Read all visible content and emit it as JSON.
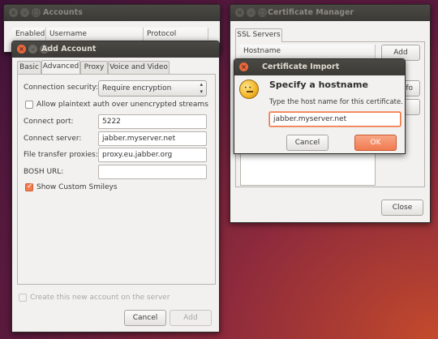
{
  "accounts": {
    "title": "Accounts",
    "columns": [
      "Enabled",
      "Username",
      "Protocol"
    ]
  },
  "cert_manager": {
    "title": "Certificate Manager",
    "tab": "SSL Servers",
    "column": "Hostname",
    "add_button": "Add",
    "info_button_partial": "fo",
    "close_button": "Close"
  },
  "add_account": {
    "title": "Add Account",
    "tabs": [
      "Basic",
      "Advanced",
      "Proxy",
      "Voice and Video"
    ],
    "active_tab": "Advanced",
    "security_label": "Connection security:",
    "security_value": "Require encryption",
    "plaintext_label": "Allow plaintext auth over unencrypted streams",
    "port_label": "Connect port:",
    "port_value": "5222",
    "server_label": "Connect server:",
    "server_value": "jabber.myserver.net",
    "proxies_label": "File transfer proxies:",
    "proxies_value": "proxy.eu.jabber.org",
    "bosh_label": "BOSH URL:",
    "bosh_value": "",
    "smileys_label": "Show Custom Smileys",
    "create_label": "Create this new account on the server",
    "cancel_button": "Cancel",
    "add_button": "Add"
  },
  "cert_import": {
    "title": "Certificate Import",
    "heading": "Specify a hostname",
    "description": "Type the host name for this certificate.",
    "hostname_value": "jabber.myserver.net",
    "cancel_button": "Cancel",
    "ok_button": "OK"
  }
}
